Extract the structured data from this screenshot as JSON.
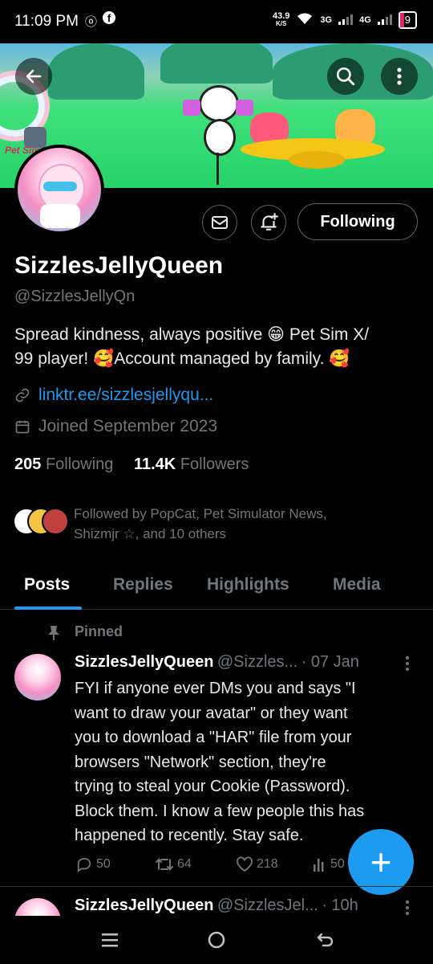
{
  "status": {
    "time": "11:09 PM",
    "net_speed": "43.9",
    "net_unit": "K/S",
    "net1": "3G",
    "net2": "4G",
    "battery": "9"
  },
  "header": {
    "back_icon": "arrow-left-icon",
    "search_icon": "search-icon",
    "more_icon": "more-vertical-icon"
  },
  "banner": {
    "game_label": "Pet Sim"
  },
  "profile": {
    "display_name": "SizzlesJellyQueen",
    "handle": "@SizzlesJellyQn",
    "bio_line1": "Spread kindness, always positive 😁 Pet Sim X/",
    "bio_line2": "99 player! 🥰Account managed by family. 🥰",
    "link": "linktr.ee/sizzlesjellyqu...",
    "joined": "Joined September 2023",
    "following_count": "205",
    "following_label": "Following",
    "followers_count": "11.4K",
    "followers_label": "Followers",
    "followed_by_line1": "Followed by PopCat, Pet Simulator News,",
    "followed_by_line2": "Shizmjr ☆, and 10 others",
    "following_button": "Following"
  },
  "tabs": [
    "Posts",
    "Replies",
    "Highlights",
    "Media"
  ],
  "pinned_label": "Pinned",
  "posts": [
    {
      "name": "SizzlesJellyQueen",
      "handle_short": "@Sizzles...",
      "time": "· 07 Jan",
      "lines": [
        "FYI if anyone ever DMs you and says \"I",
        "want to draw your avatar\" or they want",
        "you to download a \"HAR\" file from your",
        "browsers \"Network\" section, they're",
        "trying to steal your Cookie (Password).",
        "Block them. I know a few people this has",
        "happened to recently. Stay safe."
      ],
      "replies": "50",
      "reposts": "64",
      "likes": "218",
      "views": "50"
    },
    {
      "name": "SizzlesJellyQueen",
      "handle_short": "@SizzlesJel...",
      "time": "· 10h"
    }
  ],
  "fab_label": "+",
  "colors": {
    "accent": "#1d9bf0",
    "muted": "#71767b",
    "background": "#000000"
  }
}
